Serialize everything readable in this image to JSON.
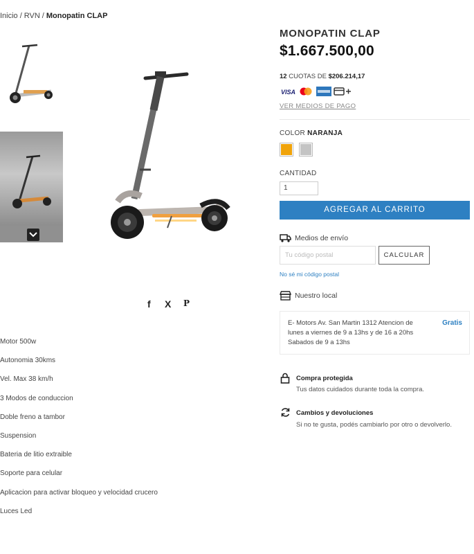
{
  "breadcrumb": {
    "items": [
      "Inicio",
      "RVN"
    ],
    "separator": "/",
    "current": "Monopatin CLAP"
  },
  "product": {
    "title": "MONOPATIN CLAP",
    "price": "$1.667.500,00",
    "installments": {
      "count": "12",
      "text": "CUOTAS DE",
      "amount": "$206.214,17"
    },
    "payment_icons": [
      "visa-icon",
      "mastercard-icon",
      "amex-icon",
      "card-plus-icon"
    ],
    "payment_link": "VER MEDIOS DE PAGO",
    "color": {
      "label": "COLOR",
      "selected": "NARANJA",
      "swatches": [
        {
          "name": "naranja",
          "hex": "#f0a30a"
        },
        {
          "name": "gris",
          "hex": "#c4c4c4"
        }
      ]
    },
    "quantity": {
      "label": "CANTIDAD",
      "value": "1"
    },
    "add_to_cart": "AGREGAR AL CARRITO"
  },
  "shipping": {
    "label": "Medios de envío",
    "postal_placeholder": "Tu código postal",
    "calculate_button": "CALCULAR",
    "unknown_postal_link": "No sé mi código postal"
  },
  "local_store": {
    "label": "Nuestro local",
    "address": "E- Motors  Av. San Martin 1312 Atencion de lunes a viernes de 9 a 13hs y de 16 a 20hs Sabados de 9 a 13hs",
    "price": "Gratis"
  },
  "guarantees": {
    "protected": {
      "title": "Compra protegida",
      "subtitle": "Tus datos cuidados durante toda la compra."
    },
    "returns": {
      "title": "Cambios y devoluciones",
      "subtitle": "Si no te gusta, podés cambiarlo por otro o devolverlo."
    }
  },
  "share": {
    "facebook": "f",
    "x": "X",
    "pinterest": "P"
  },
  "features": [
    "Motor 500w",
    "Autonomia 30kms",
    "Vel. Max 38 km/h",
    "3 Modos de conduccion",
    "Doble freno a tambor",
    "Suspension",
    "Bateria de litio extraible",
    "Soporte para celular",
    "Aplicacion para activar bloqueo y velocidad crucero",
    "Luces Led"
  ],
  "colors": {
    "accent": "#2e80c2",
    "orange": "#f0a30a"
  }
}
